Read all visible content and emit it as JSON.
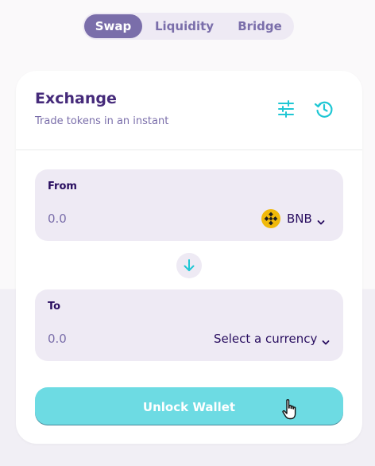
{
  "tabs": {
    "swap": "Swap",
    "liquidity": "Liquidity",
    "bridge": "Bridge"
  },
  "exchange": {
    "title": "Exchange",
    "subtitle": "Trade tokens in an instant"
  },
  "from": {
    "label": "From",
    "placeholder": "0.0",
    "token": "BNB"
  },
  "to": {
    "label": "To",
    "placeholder": "0.0",
    "select_label": "Select a currency"
  },
  "unlock_label": "Unlock Wallet",
  "colors": {
    "primary": "#7a6eaa",
    "accent": "#6ddbe3",
    "cyan_icon": "#1fc7d4",
    "dark_text": "#280d5f",
    "title_text": "#452a7a",
    "bnb_yellow": "#f0b90b"
  },
  "icons": [
    "settings-sliders-icon",
    "history-icon",
    "bnb-token-icon",
    "chevron-down-icon",
    "arrow-down-icon",
    "hand-pointer-cursor"
  ]
}
